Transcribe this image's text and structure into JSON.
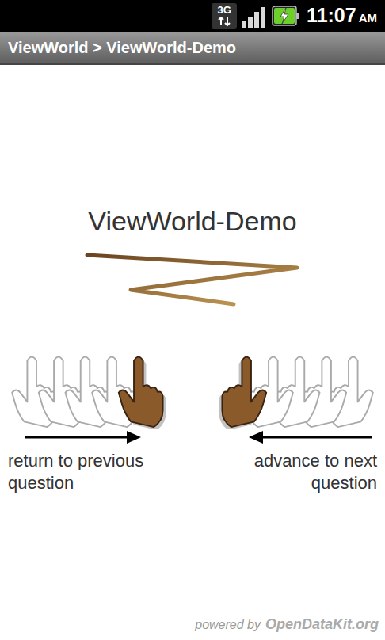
{
  "status_bar": {
    "network": "3G",
    "signal": {
      "level": 1
    },
    "battery": {
      "level": 1,
      "charging": true
    },
    "time": "11:07",
    "ampm": "AM"
  },
  "title_bar": {
    "title": "ViewWorld > ViewWorld-Demo"
  },
  "form": {
    "title": "ViewWorld-Demo"
  },
  "navigation": [
    {
      "label": "return to previous question"
    },
    {
      "label": "advance to next question"
    }
  ],
  "footer": {
    "prefix": "powered by",
    "brand": "OpenDataKit.org"
  }
}
